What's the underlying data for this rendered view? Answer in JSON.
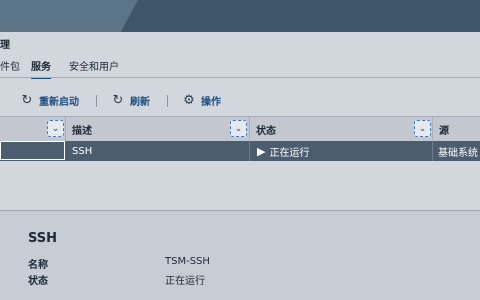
{
  "header": {
    "title": "理"
  },
  "tabs": [
    {
      "label": "件包",
      "active": false
    },
    {
      "label": "服务",
      "active": true
    },
    {
      "label": "安全和用户",
      "active": false
    }
  ],
  "toolbar": {
    "restart": {
      "label": "重新启动",
      "icon": "restart-icon"
    },
    "refresh": {
      "label": "刷新",
      "icon": "refresh-icon"
    },
    "actions": {
      "label": "操作",
      "icon": "gear-icon"
    }
  },
  "table": {
    "columns": [
      "描述",
      "状态",
      "源"
    ],
    "rows": [
      {
        "name": "",
        "description": "SSH",
        "status": "正在运行",
        "source": "基础系统",
        "selected": true
      }
    ]
  },
  "details": {
    "title": "SSH",
    "fields": [
      {
        "label": "名称",
        "value": "TSM-SSH"
      },
      {
        "label": "状态",
        "value": "正在运行"
      }
    ]
  },
  "colors": {
    "accent": "#1d4f82",
    "selected_row": "#4b5d6f",
    "topbar": "#3e5668"
  }
}
